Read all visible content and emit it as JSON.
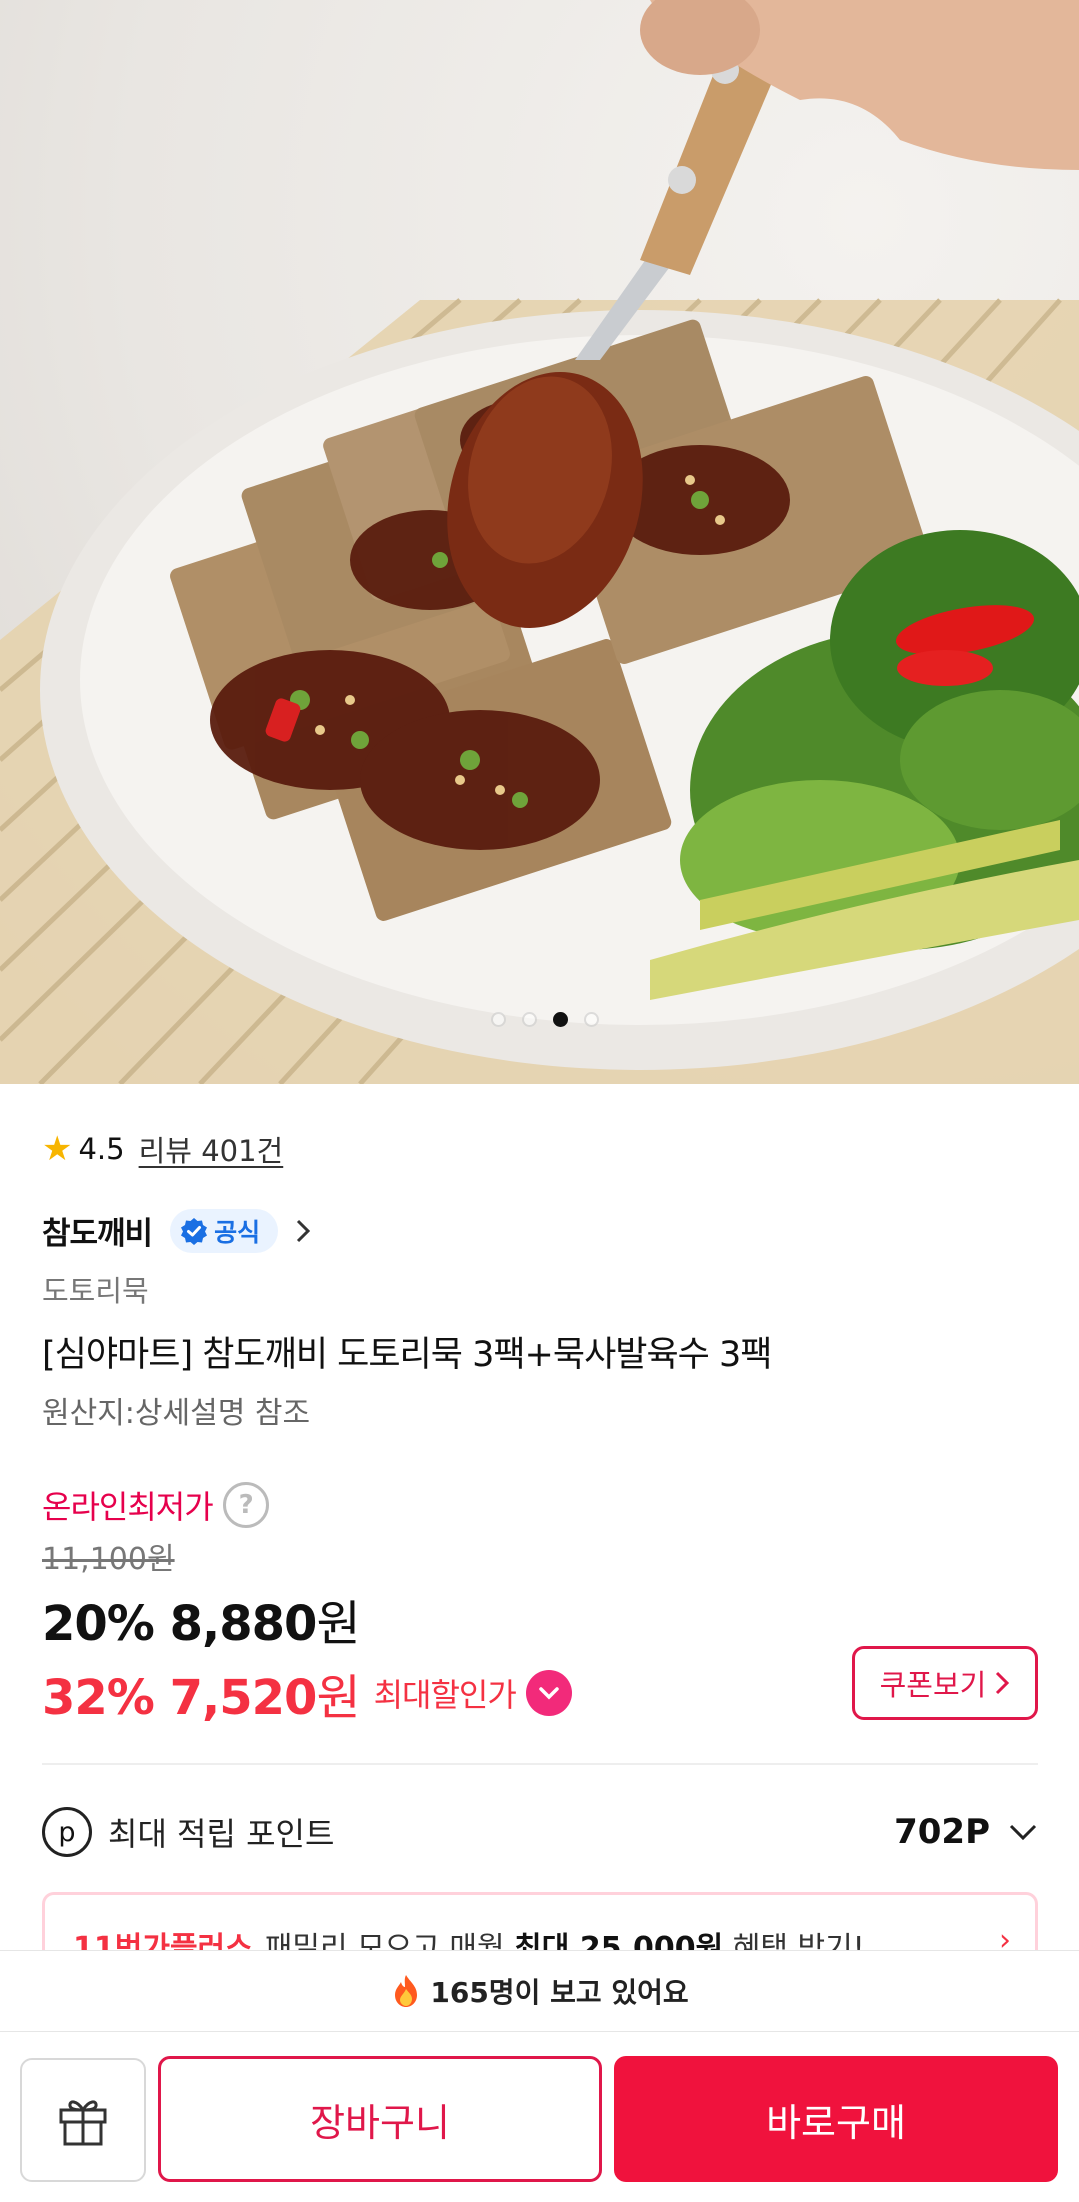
{
  "gallery": {
    "total_images": 4,
    "active_index": 3
  },
  "rating": {
    "score": "4.5",
    "review_link": "리뷰 401건"
  },
  "seller": {
    "name": "참도깨비",
    "badge": "공식"
  },
  "product": {
    "category": "도토리묵",
    "title": "[심야마트] 참도깨비 도토리묵 3팩+묵사발육수 3팩",
    "origin": "원산지:상세설명 참조"
  },
  "price": {
    "lowest_label": "온라인최저가",
    "original": "11,100",
    "won": "원",
    "discount_percent": "20%",
    "discount_price": "8,880",
    "max_percent": "32%",
    "max_price": "7,520",
    "max_label": "최대할인가",
    "coupon_button": "쿠폰보기"
  },
  "points": {
    "icon_letter": "p",
    "label": "최대 적립 포인트",
    "value": "702P"
  },
  "promo": {
    "brand": "11번가플러스",
    "text_prefix": "패밀리 모으고 매월",
    "text_bold": "최대 25,000원",
    "text_suffix": "혜택 받기!"
  },
  "viewers": {
    "text": "165명이 보고 있어요"
  },
  "actions": {
    "cart": "장바구니",
    "buy": "바로구매"
  },
  "colors": {
    "accent_red": "#f0123d",
    "pink": "#e6004c",
    "official_blue": "#1a6fe3"
  }
}
